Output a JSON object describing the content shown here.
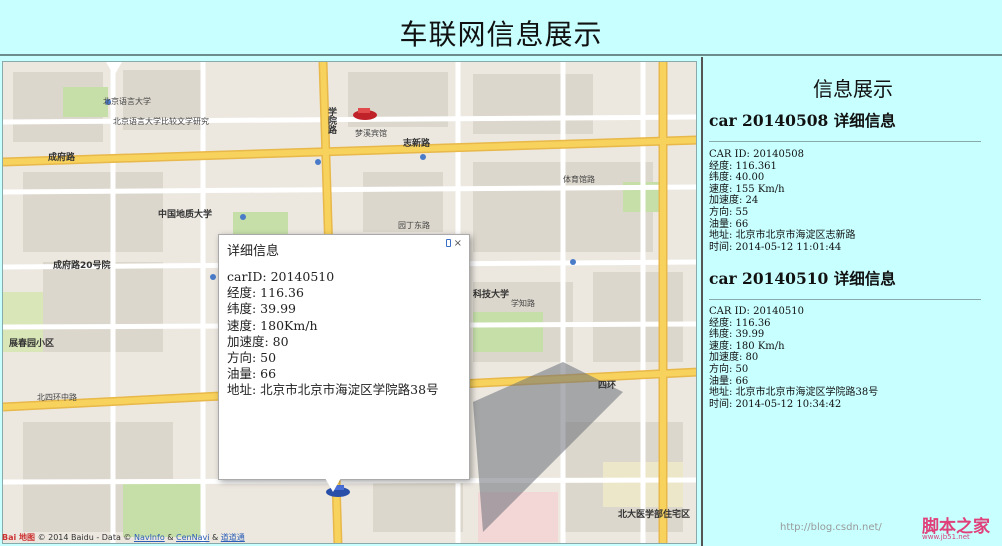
{
  "header": {
    "title": "车联网信息展示"
  },
  "map": {
    "labels": [
      {
        "text": "北京语言大学"
      },
      {
        "text": "北京语言大学比较文学研究"
      },
      {
        "text": "成府路"
      },
      {
        "text": "学院路"
      },
      {
        "text": "志新路"
      },
      {
        "text": "中国地质大学"
      },
      {
        "text": "成府路20号院"
      },
      {
        "text": "展春园小区"
      },
      {
        "text": "科技大学"
      },
      {
        "text": "四环"
      },
      {
        "text": "北四环中路"
      },
      {
        "text": "北大医学部住宅区"
      },
      {
        "text": "学知路"
      },
      {
        "text": "体育馆路"
      },
      {
        "text": "梦溪宾馆"
      },
      {
        "text": "园丁东路"
      }
    ],
    "copyright": {
      "prefix": "© 2014 Baidu - Data © ",
      "link1": "NavInfo",
      "amp": " & ",
      "link2": "CenNavi",
      "amp2": " & ",
      "link3": "道道通"
    },
    "logo": "Bai 地图"
  },
  "popup": {
    "title": "详细信息",
    "close_glyph": "×",
    "lines": [
      "carID: 20140510",
      "经度: 116.36",
      "纬度: 39.99",
      "速度: 180Km/h",
      "加速度: 80",
      "方向: 50",
      "油量: 66",
      "地址: 北京市北京市海淀区学院路38号"
    ]
  },
  "side": {
    "title": "信息展示",
    "cars": [
      {
        "heading": "car 20140508 详细信息",
        "lines": [
          "CAR ID: 20140508",
          "经度: 116.361",
          "纬度: 40.00",
          "速度: 155 Km/h",
          "加速度: 24",
          "方向: 55",
          "油量: 66",
          "地址: 北京市北京市海淀区志新路",
          "时间: 2014-05-12 11:01:44"
        ]
      },
      {
        "heading": "car 20140510 详细信息",
        "lines": [
          "CAR ID: 20140510",
          "经度: 116.36",
          "纬度: 39.99",
          "速度: 180 Km/h",
          "加速度: 80",
          "方向: 50",
          "油量: 66",
          "地址: 北京市北京市海淀区学院路38号",
          "时间: 2014-05-12 10:34:42"
        ]
      }
    ]
  },
  "watermark": {
    "url": "http://blog.csdn.net/",
    "brand": "脚本之家",
    "brand_sub": "www.jb51.net"
  },
  "colors": {
    "background": "#c8ffff",
    "road_major": "#f7d25c",
    "road_minor": "#ffffff",
    "green": "#c6dfa8",
    "block": "#d9d4ca"
  }
}
